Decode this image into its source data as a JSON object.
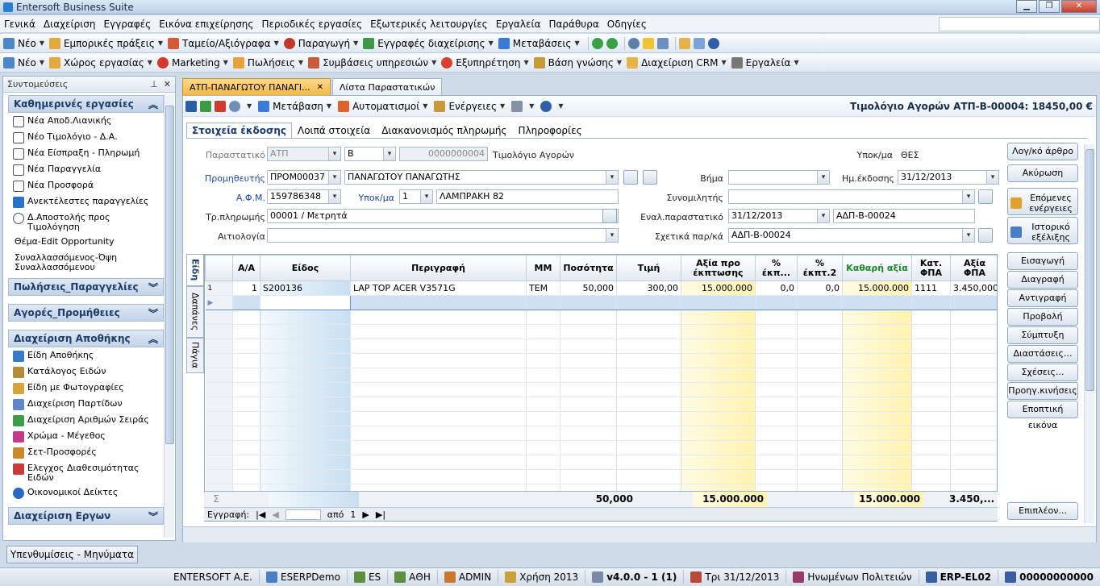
{
  "window": {
    "title": "Entersoft Business Suite"
  },
  "menu": [
    "Γενικά",
    "Διαχείριση",
    "Εγγραφές",
    "Εικόνα επιχείρησης",
    "Περιοδικές εργασίες",
    "Εξωτερικές λειτουργίες",
    "Εργαλεία",
    "Παράθυρα",
    "Οδηγίες"
  ],
  "toolbar1": [
    "Νέο",
    "Εμπορικές πράξεις",
    "Ταμείο/Αξιόγραφα",
    "Παραγωγή",
    "Εγγραφές διαχείρισης",
    "Μεταβάσεις"
  ],
  "toolbar2": [
    "Νέο",
    "Χώρος εργασίας",
    "Marketing",
    "Πωλήσεις",
    "Συμβάσεις υπηρεσιών",
    "Εξυπηρέτηση",
    "Βάση γνώσης",
    "Διαχείριση CRM",
    "Εργαλεία"
  ],
  "sidebar": {
    "title": "Συντομεύσεις",
    "group1": "Καθημερινές εργασίες",
    "group1_items": [
      "Νέα Αποδ.Λιανικής",
      "Νέο Τιμολόγιο - Δ.Α.",
      "Νέα Είσπραξη - Πληρωμή",
      "Νέα Παραγγελία",
      "Νέα Προσφορά",
      "Ανεκτέλεστες παραγγελίες",
      "Δ.Αποστολής προς Τιμολόγηση",
      "Θέμα-Edit Opportunity",
      "Συναλλασσόμενος-Όψη Συναλλασσόμενου"
    ],
    "group2": "Πωλήσεις_Παραγγελίες",
    "group3": "Αγορές_Προμήθειες",
    "group4": "Διαχείριση Αποθήκης",
    "group4_items": [
      "Είδη Αποθήκης",
      "Κατάλογος Ειδών",
      "Είδη με Φωτογραφίες",
      "Διαχείριση Παρτίδων",
      "Διαχείριση Αριθμών Σειράς",
      "Χρώμα - Μέγεθος",
      "Σετ-Προσφορές",
      "Ελεγχος Διαθεσιμότητας Ειδών",
      "Οικονομικοί Δείκτες"
    ],
    "group5": "Διαχείριση Εργων",
    "resp_button": "Υπενθυμίσεις - Μηνύματα"
  },
  "doctabs": [
    "ΑΤΠ-ΠΑΝΑΓΩΤΟΥ ΠΑΝΑΓΙ...",
    "Λίστα Παραστατικών"
  ],
  "maintoolbar": {
    "transition": "Μετάβαση",
    "automations": "Αυτοματισμοί",
    "actions": "Ενέργειες"
  },
  "doc_title": "Τιμολόγιο Αγορών ΑΤΠ-Β-00004: 18450,00 €",
  "formtabs": [
    "Στοιχεία έκδοσης",
    "Λοιπά στοιχεία",
    "Διακανονισμός πληρωμής",
    "Πληροφορίες"
  ],
  "form": {
    "parastatiko_lbl": "Παραστατικό",
    "parastatiko": "ΑΤΠ",
    "series": "Β",
    "number": "0000000004",
    "doc_type": "Τιμολόγιο Αγορών",
    "ypok_lbl": "Υποκ/μα",
    "ypok": "ΘΕΣ",
    "supplier_lbl": "Προμηθευτής",
    "supplier_code": "ΠΡΟΜ00037",
    "supplier_name": "ΠΑΝΑΓΩΤΟΥ ΠΑΝΑΓΩΤΗΣ",
    "step_lbl": "Βήμα",
    "date_lbl": "Ημ.έκδοσης",
    "date": "31/12/2013",
    "afm_lbl": "Α.Φ.Μ.",
    "afm": "159786348",
    "ypok2_lbl": "Υποκ/μα",
    "ypok2": "1",
    "address": "ΛΑΜΠΡΑΚΗ 82",
    "partner_lbl": "Συνομιλητής",
    "payment_lbl": "Τρ.πληρωμής",
    "payment": "00001 / Μετρητά",
    "alt_lbl": "Εναλ.παραστατικό",
    "alt_date": "31/12/2013",
    "alt_doc": "ΑΔΠ-Β-00024",
    "reason_lbl": "Αιτιολογία",
    "rel_lbl": "Σχετικά παρ/κά",
    "rel": "ΑΔΠ-Β-00024"
  },
  "rightbuttons_top": [
    "Λογ/κό άρθρο",
    "Ακύρωση",
    "Επόμενες ενέργειες",
    "Ιστορικό εξέλιξης"
  ],
  "rightbuttons": [
    "Εισαγωγή",
    "Διαγραφή",
    "Αντιγραφή",
    "Προβολή",
    "Σύμπτυξη",
    "Διαστάσεις...",
    "Σχέσεις...",
    "Προηγ.κινήσεις",
    "Εποπτική εικόνα"
  ],
  "more_button": "Επιπλέον...",
  "vtabs": [
    "Είδη",
    "Δαπάνες",
    "Πάγια"
  ],
  "grid": {
    "columns": [
      "Α/Α",
      "Είδος",
      "Περιγραφή",
      "ΜΜ",
      "Ποσότητα",
      "Τιμή",
      "Αξία προ έκπτωσης",
      "% έκπ...",
      "% έκπτ.2",
      "Καθαρή αξία",
      "Κατ. ΦΠΑ",
      "Αξία ΦΠΑ"
    ],
    "rows": [
      [
        "1",
        "S200136",
        "LAP TOP ACER V3571G",
        "TEM",
        "50,000",
        "300,00",
        "15.000.000",
        "0,0",
        "0,0",
        "15.000.000",
        "1111",
        "3.450,000"
      ]
    ],
    "sums": {
      "qty": "50,000",
      "gross": "15.000.000",
      "net": "15.000.000",
      "vat": "3.450,..."
    }
  },
  "nav": {
    "label": "Εγγραφή:",
    "of": "από",
    "total": "1"
  },
  "status": [
    "ENTERSOFT A.E.",
    "ESERPDemo",
    "ES",
    "ΑΘΗ",
    "ADMIN",
    "Χρήση 2013",
    "v4.0.0 - 1 (1)",
    "Τρι 31/12/2013",
    "Ηνωμένων Πολιτειών",
    "ERP-EL02",
    "00000000000"
  ]
}
